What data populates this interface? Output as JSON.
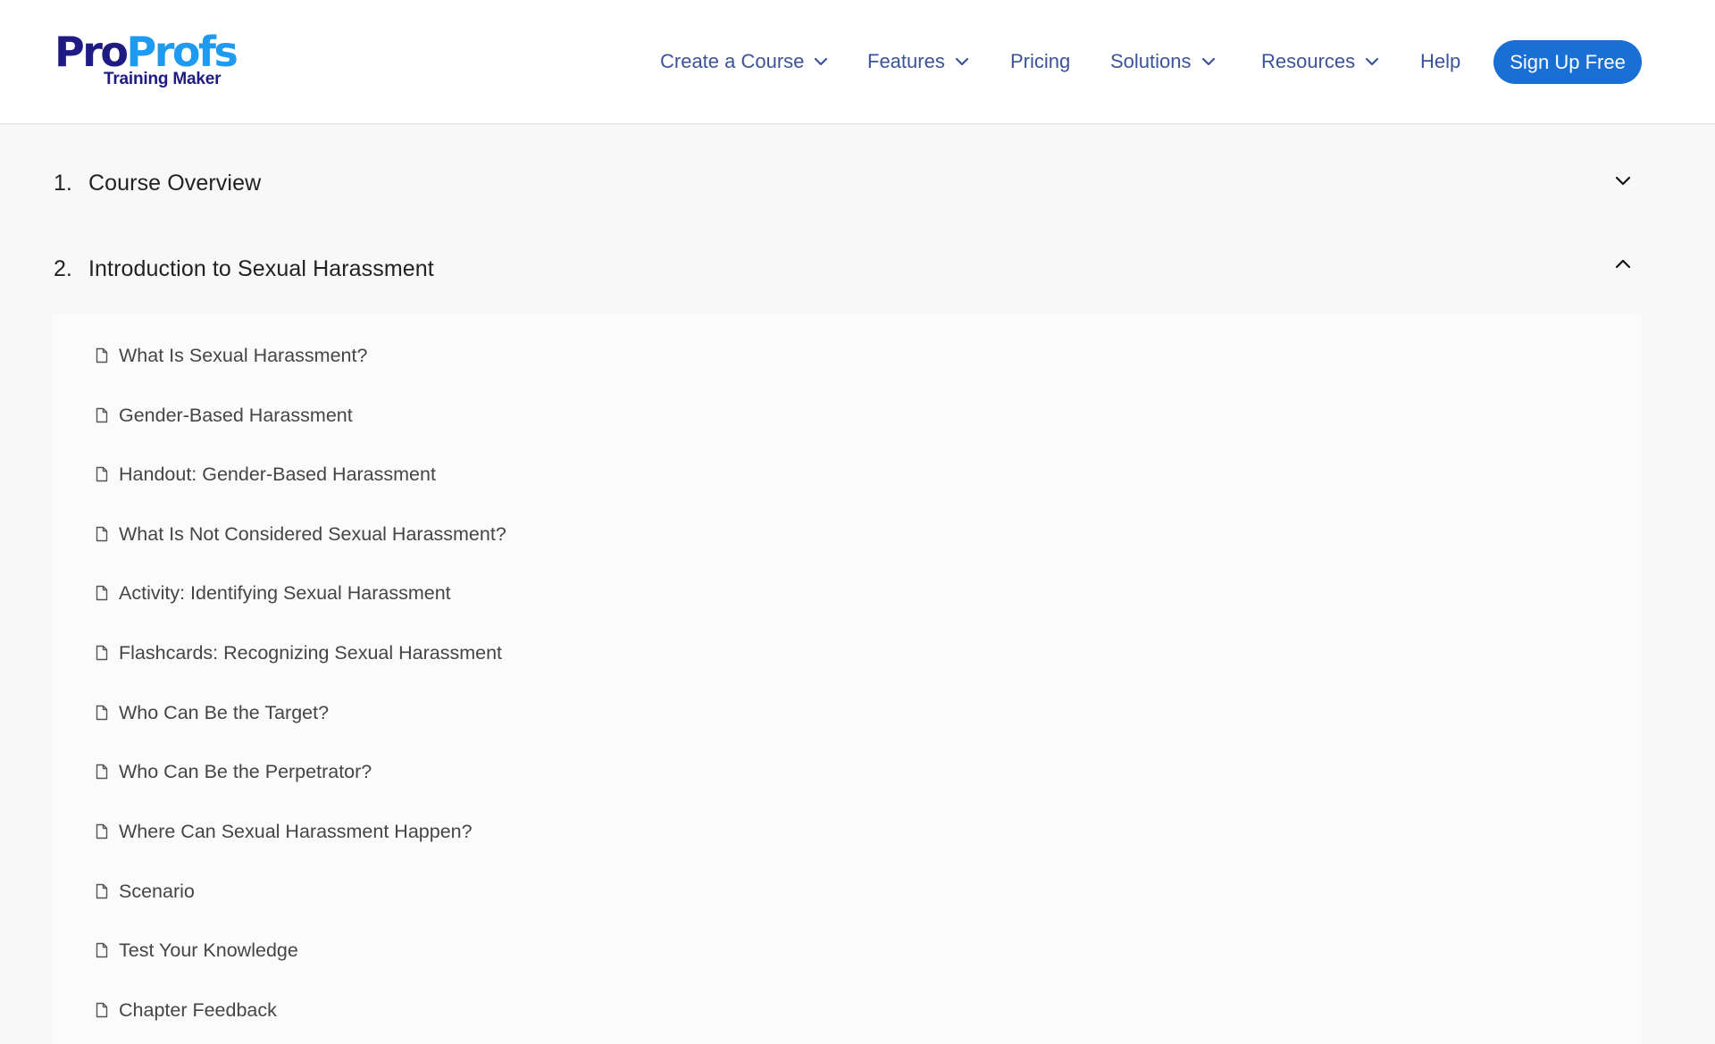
{
  "header": {
    "logo": {
      "part1": "Pro",
      "part2": "Profs",
      "subtitle": "Training Maker",
      "colors": {
        "part1": "#1e1b82",
        "part2": "#1e9bf0"
      }
    },
    "nav": [
      {
        "label": "Create a Course",
        "has_dropdown": true
      },
      {
        "label": "Features",
        "has_dropdown": true
      },
      {
        "label": "Pricing",
        "has_dropdown": false
      },
      {
        "label": "Solutions",
        "has_dropdown": true
      },
      {
        "label": "Resources",
        "has_dropdown": true
      },
      {
        "label": "Help",
        "has_dropdown": false
      }
    ],
    "cta_label": "Sign Up Free",
    "colors": {
      "nav_text": "#3b5399",
      "cta_bg": "#1a6fd4"
    }
  },
  "sections": [
    {
      "number": "1.",
      "title": "Course Overview",
      "expanded": false,
      "toggle_icon": "chevron-down-icon"
    },
    {
      "number": "2.",
      "title": "Introduction to Sexual Harassment",
      "expanded": true,
      "toggle_icon": "chevron-up-icon",
      "lessons": [
        {
          "label": "What Is Sexual Harassment?",
          "icon": "document-icon"
        },
        {
          "label": "Gender-Based Harassment",
          "icon": "document-icon"
        },
        {
          "label": "Handout: Gender-Based Harassment",
          "icon": "document-icon"
        },
        {
          "label": "What Is Not Considered Sexual Harassment?",
          "icon": "document-icon"
        },
        {
          "label": "Activity: Identifying Sexual Harassment",
          "icon": "document-icon"
        },
        {
          "label": "Flashcards: Recognizing Sexual Harassment",
          "icon": "document-icon"
        },
        {
          "label": "Who Can Be the Target?",
          "icon": "document-icon"
        },
        {
          "label": "Who Can Be the Perpetrator?",
          "icon": "document-icon"
        },
        {
          "label": "Where Can Sexual Harassment Happen?",
          "icon": "document-icon"
        },
        {
          "label": "Scenario",
          "icon": "document-icon"
        },
        {
          "label": "Test Your Knowledge",
          "icon": "document-icon"
        },
        {
          "label": "Chapter Feedback",
          "icon": "document-icon"
        }
      ]
    }
  ]
}
